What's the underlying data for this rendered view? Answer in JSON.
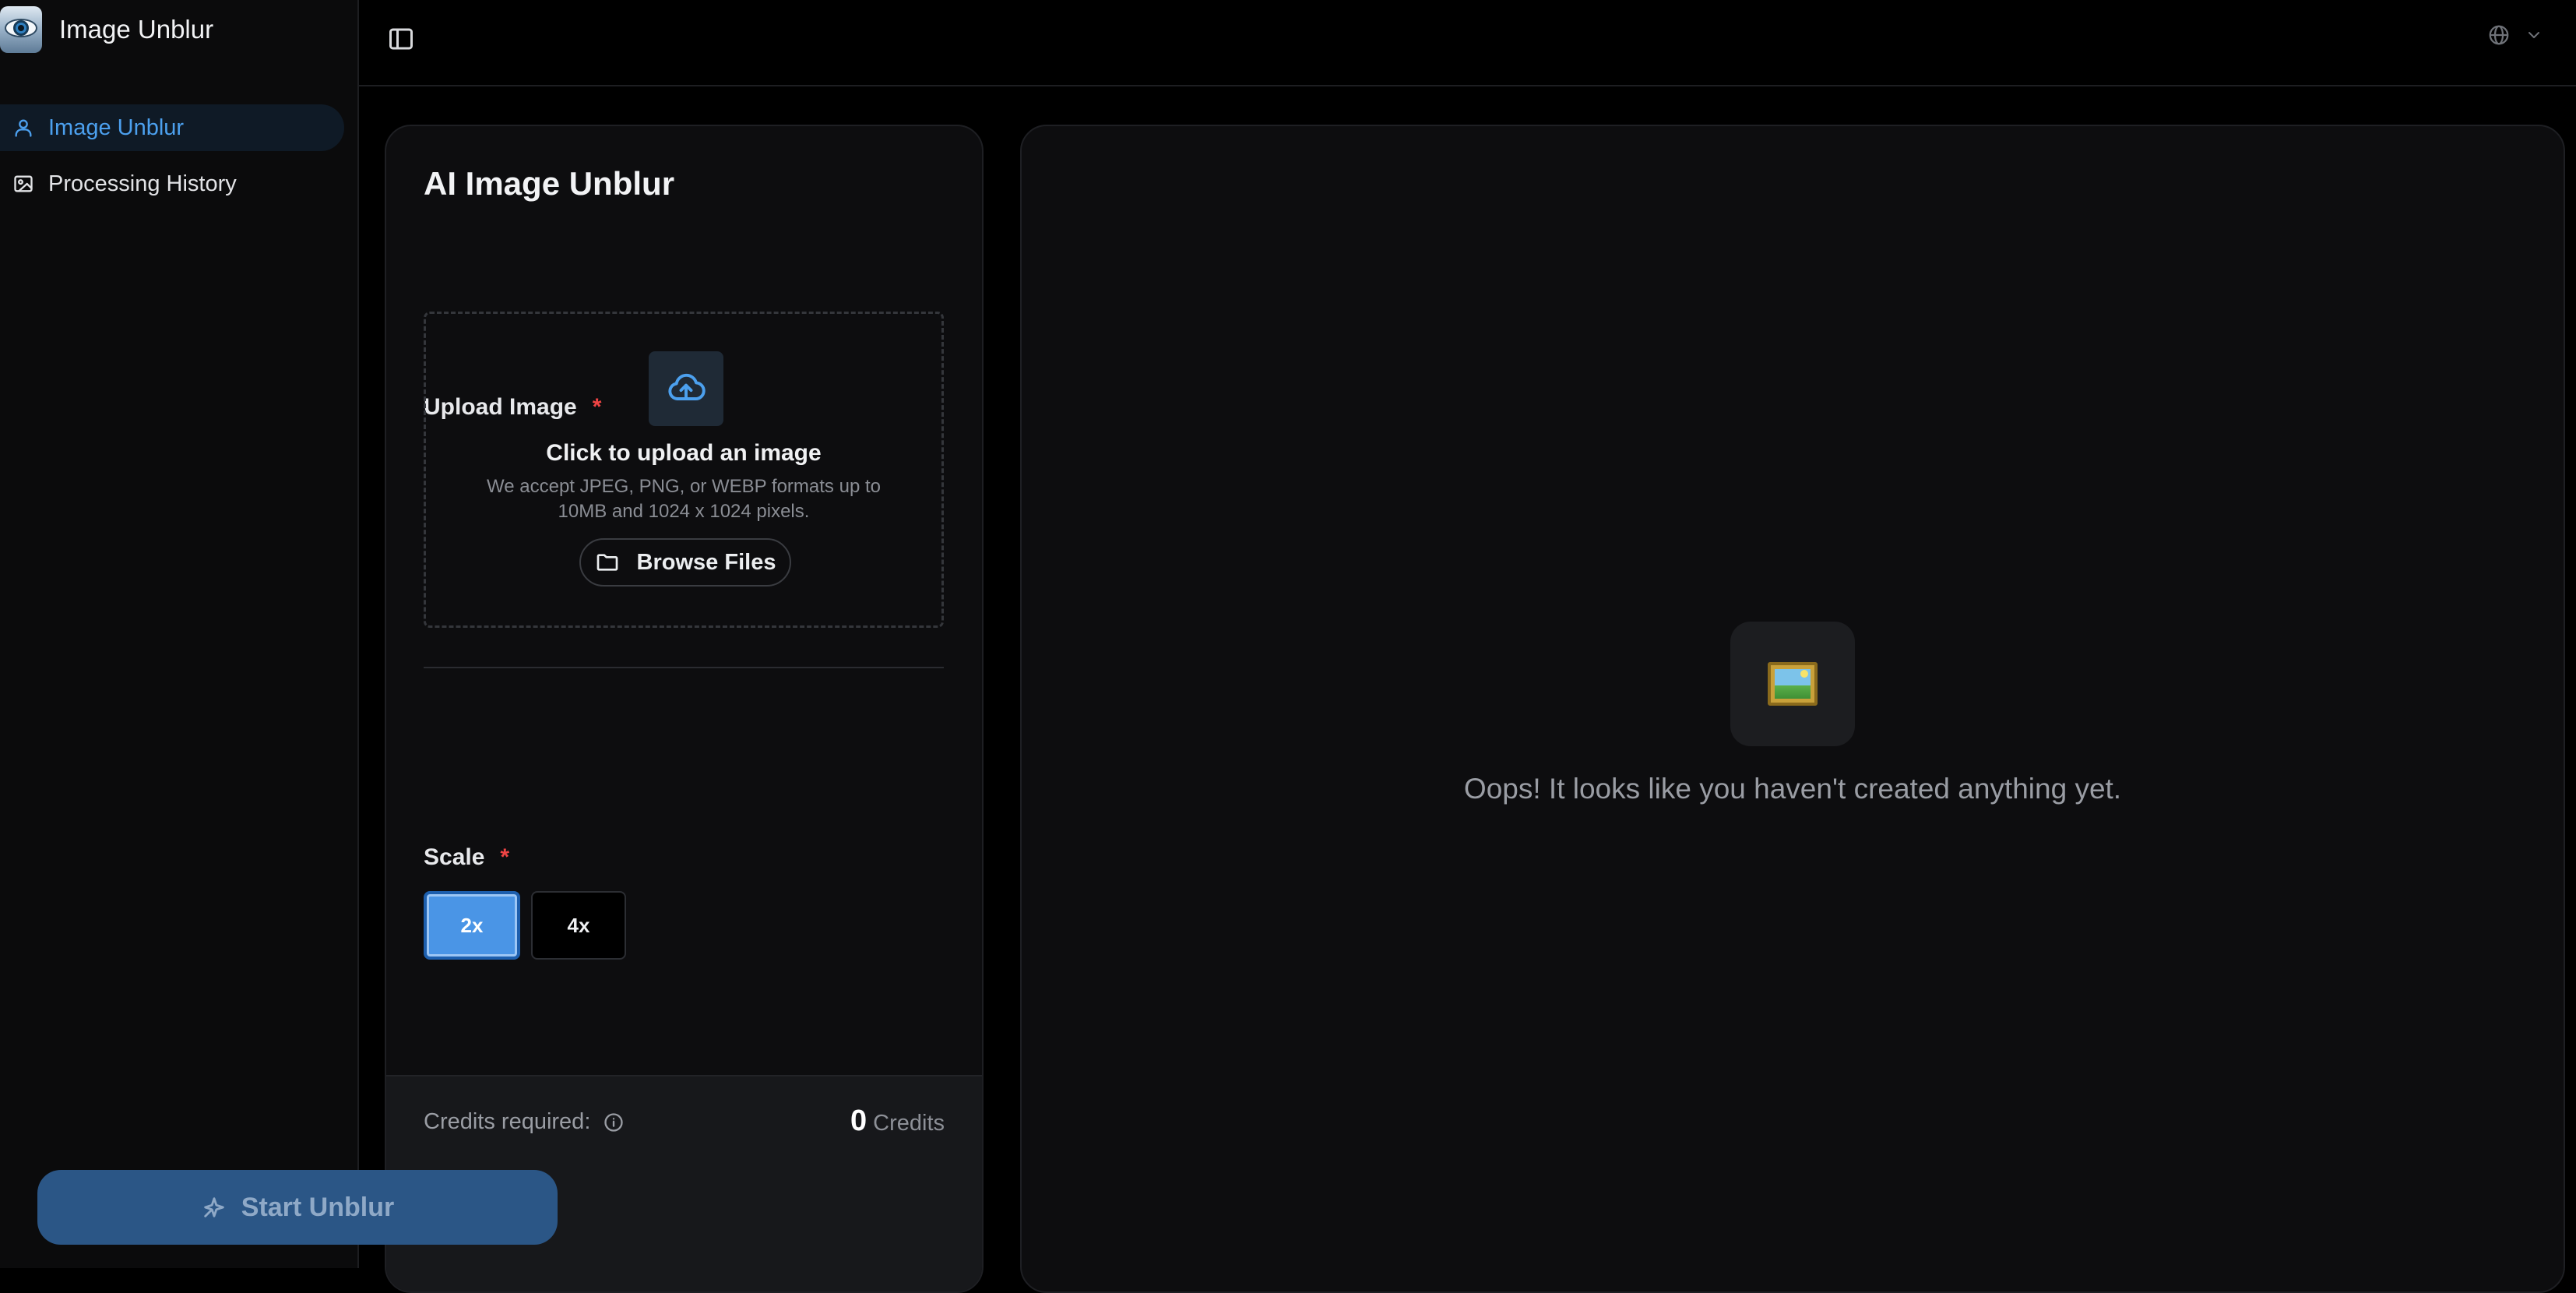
{
  "app": {
    "title": "Image Unblur"
  },
  "sidebar": {
    "items": [
      {
        "label": "Image Unblur",
        "icon": "user-icon",
        "active": true
      },
      {
        "label": "Processing History",
        "icon": "image-icon",
        "active": false
      }
    ]
  },
  "topbar": {
    "toggle_icon": "sidebar-toggle-icon",
    "language_icon": "globe-icon"
  },
  "form": {
    "title": "AI Image Unblur",
    "upload": {
      "label": "Upload Image",
      "required_mark": "*",
      "title": "Click to upload an image",
      "description": "We accept JPEG, PNG, or WEBP formats up to 10MB and 1024 x 1024 pixels.",
      "browse_label": "Browse Files"
    },
    "scale": {
      "label": "Scale",
      "required_mark": "*",
      "options": [
        "2x",
        "4x"
      ],
      "selected": "2x"
    },
    "credits": {
      "label": "Credits required:",
      "value": "0",
      "unit": "Credits"
    },
    "submit_label": "Start Unblur"
  },
  "preview": {
    "empty_text": "Oops! It looks like you haven't created anything yet.",
    "empty_icon": "framed-picture-icon"
  },
  "colors": {
    "accent": "#4ca0ee",
    "selected_scale": "#4a95e6",
    "submit_button": "#2b5686",
    "required": "#ef4444"
  }
}
